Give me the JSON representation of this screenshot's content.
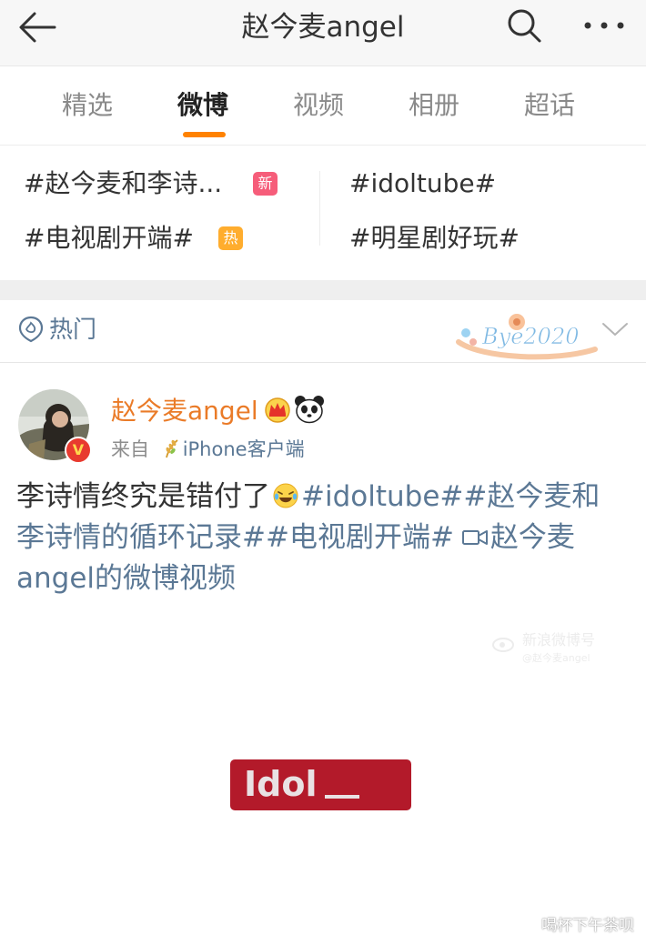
{
  "header": {
    "title": "赵今麦angel",
    "back_icon": "arrow-left-icon",
    "search_icon": "search-icon",
    "more_icon": "more-horizontal-icon"
  },
  "tabs": [
    {
      "label": "精选",
      "active": false
    },
    {
      "label": "微博",
      "active": true
    },
    {
      "label": "视频",
      "active": false
    },
    {
      "label": "相册",
      "active": false
    },
    {
      "label": "超话",
      "active": false
    }
  ],
  "topics": [
    {
      "label": "#赵今麦和李诗...",
      "badge": "新"
    },
    {
      "label": "#idoltube#",
      "badge": ""
    },
    {
      "label": "#电视剧开端#",
      "badge": "热"
    },
    {
      "label": "#明星剧好玩#",
      "badge": ""
    }
  ],
  "filter": {
    "label": "热门",
    "sticker_text": "Bye2020"
  },
  "post": {
    "username": "赵今麦angel",
    "source_prefix": "来自",
    "source_client": "iPhone客户端",
    "verified_mark": "V",
    "text_plain": "李诗情终究是错付了",
    "tag1": "#idoltube#",
    "tag2": "#赵今麦和李诗情的循环记录#",
    "tag3": "#电视剧开端#",
    "video_link": "赵今麦angel的微博视频",
    "video_watermark": "新浪微博号",
    "video_watermark_sub": "@赵今麦angel",
    "video_card_text": "Idol"
  },
  "corner_watermark": "喝杯下午茶呗",
  "colors": {
    "accent": "#ff8200",
    "link": "#5b7895",
    "username": "#ea7b28",
    "badge_new": "#f65d7a",
    "badge_hot": "#ffad2e",
    "idol_card": "#b31a2a"
  }
}
